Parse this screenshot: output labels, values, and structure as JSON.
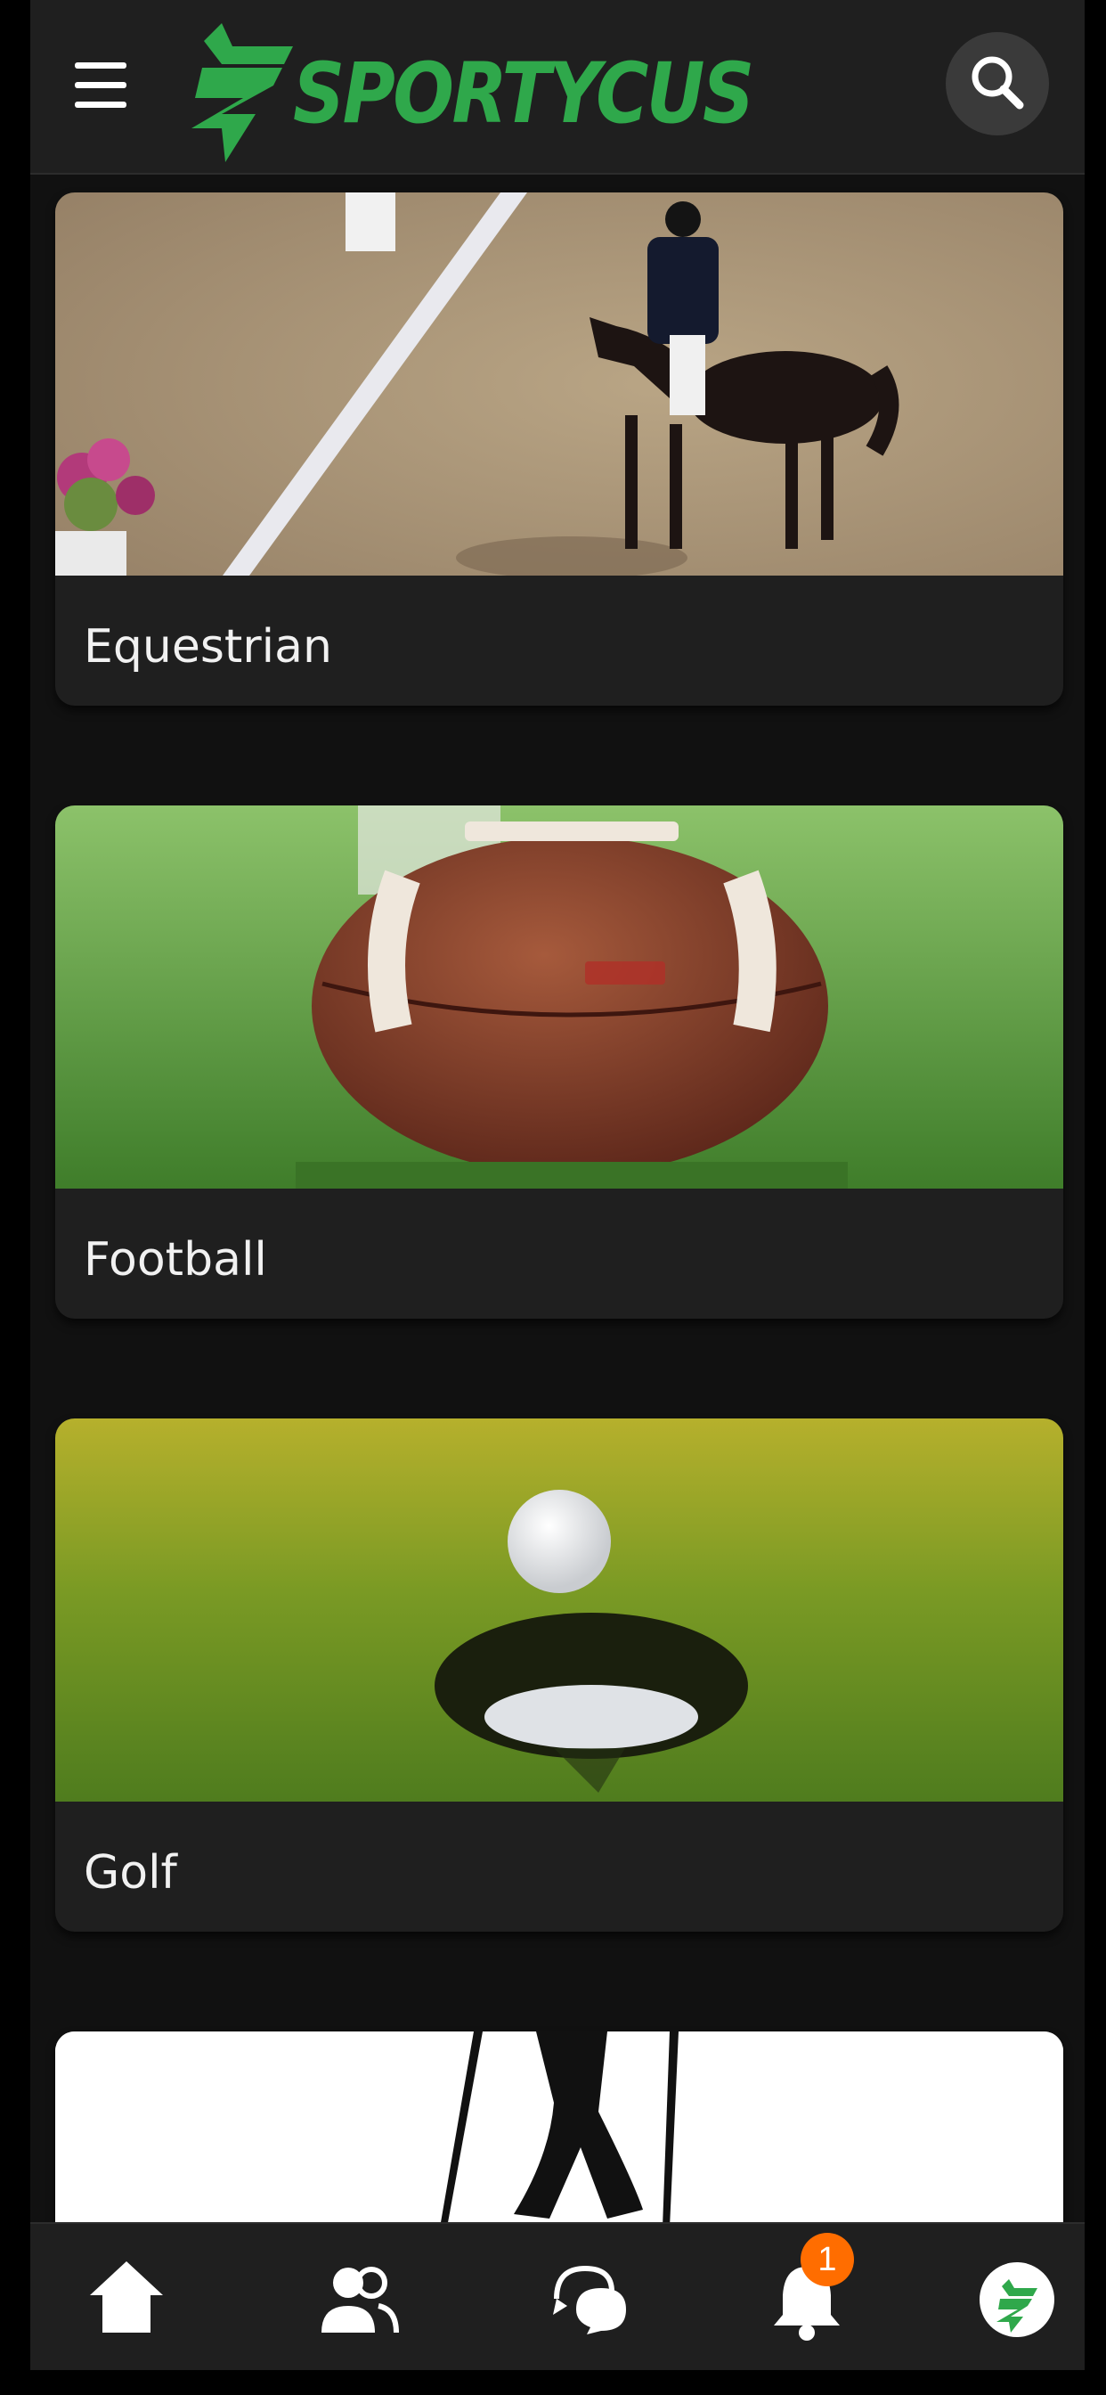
{
  "app": {
    "name": "SPORTYCUS",
    "brand_color": "#2fa84b",
    "header_color": "#1f1f1f",
    "background_color": "#111111"
  },
  "header": {
    "menu_icon": "hamburger-menu-icon",
    "search_icon": "search-icon"
  },
  "feed": {
    "cards": [
      {
        "label": "Equestrian",
        "image": "dressage horse and rider in arena"
      },
      {
        "label": "Football",
        "image": "american football on grass"
      },
      {
        "label": "Golf",
        "image": "golf ball at edge of hole"
      },
      {
        "label": "",
        "image": "silhouette of person on white background"
      }
    ]
  },
  "bottom_nav": {
    "items": [
      {
        "name": "home",
        "icon": "home-icon"
      },
      {
        "name": "friends",
        "icon": "users-icon"
      },
      {
        "name": "chat",
        "icon": "chat-bubbles-icon"
      },
      {
        "name": "notifications",
        "icon": "bell-icon",
        "badge": "1"
      },
      {
        "name": "profile",
        "icon": "sportycus-logo-icon"
      }
    ],
    "badge_color": "#ff6d00"
  }
}
